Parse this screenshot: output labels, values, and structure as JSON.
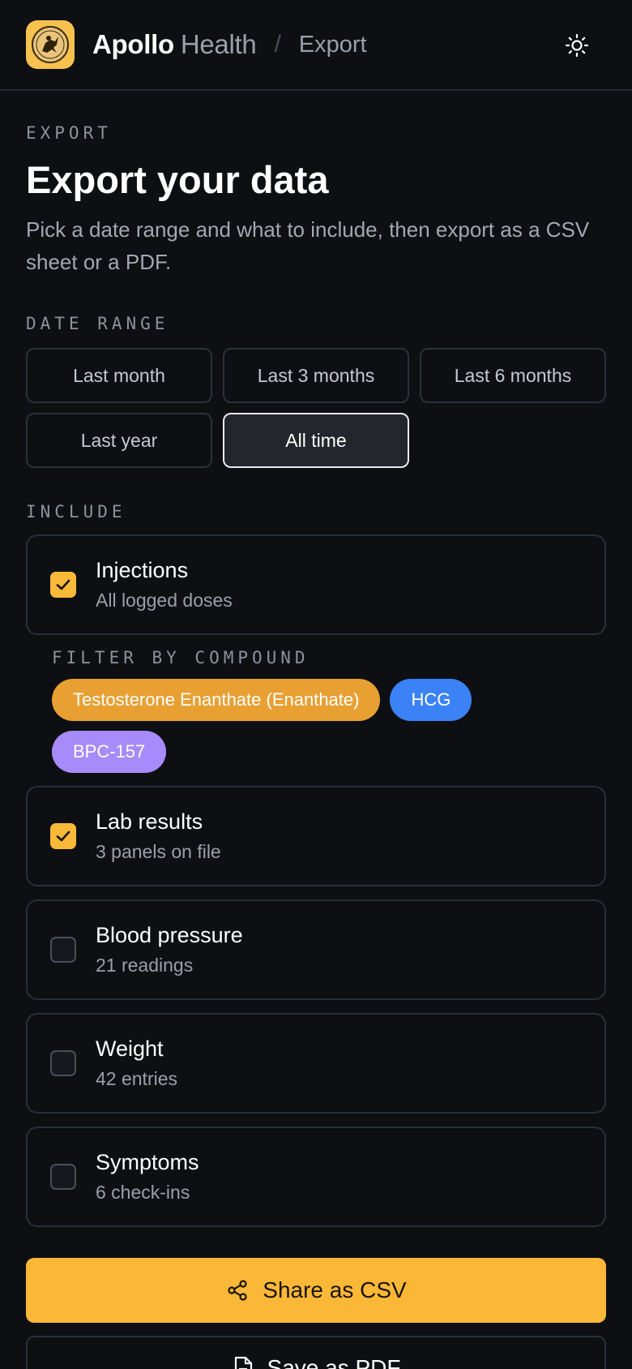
{
  "header": {
    "brand_primary": "Apollo",
    "brand_secondary": "Health",
    "separator": "/",
    "breadcrumb": "Export"
  },
  "page": {
    "eyebrow": "EXPORT",
    "title": "Export your data",
    "description": "Pick a date range and what to include, then export as a CSV sheet or a PDF."
  },
  "date_range": {
    "label": "DATE RANGE",
    "options": [
      {
        "label": "Last month",
        "selected": false
      },
      {
        "label": "Last 3 months",
        "selected": false
      },
      {
        "label": "Last 6 months",
        "selected": false
      },
      {
        "label": "Last year",
        "selected": false
      },
      {
        "label": "All time",
        "selected": true
      }
    ]
  },
  "include": {
    "label": "INCLUDE",
    "items": [
      {
        "title": "Injections",
        "subtitle": "All logged doses",
        "checked": true
      },
      {
        "title": "Lab results",
        "subtitle": "3 panels on file",
        "checked": true
      },
      {
        "title": "Blood pressure",
        "subtitle": "21 readings",
        "checked": false
      },
      {
        "title": "Weight",
        "subtitle": "42 entries",
        "checked": false
      },
      {
        "title": "Symptoms",
        "subtitle": "6 check-ins",
        "checked": false
      }
    ]
  },
  "compound_filter": {
    "label": "FILTER BY COMPOUND",
    "chips": [
      {
        "label": "Testosterone Enanthate (Enanthate)",
        "color": "#e8a033"
      },
      {
        "label": "HCG",
        "color": "#3b82f6"
      },
      {
        "label": "BPC-157",
        "color": "#a78bfa"
      }
    ]
  },
  "actions": {
    "csv_label": "Share as CSV",
    "pdf_label": "Save as PDF"
  },
  "colors": {
    "accent": "#fbb838",
    "background": "#0d0f13"
  }
}
